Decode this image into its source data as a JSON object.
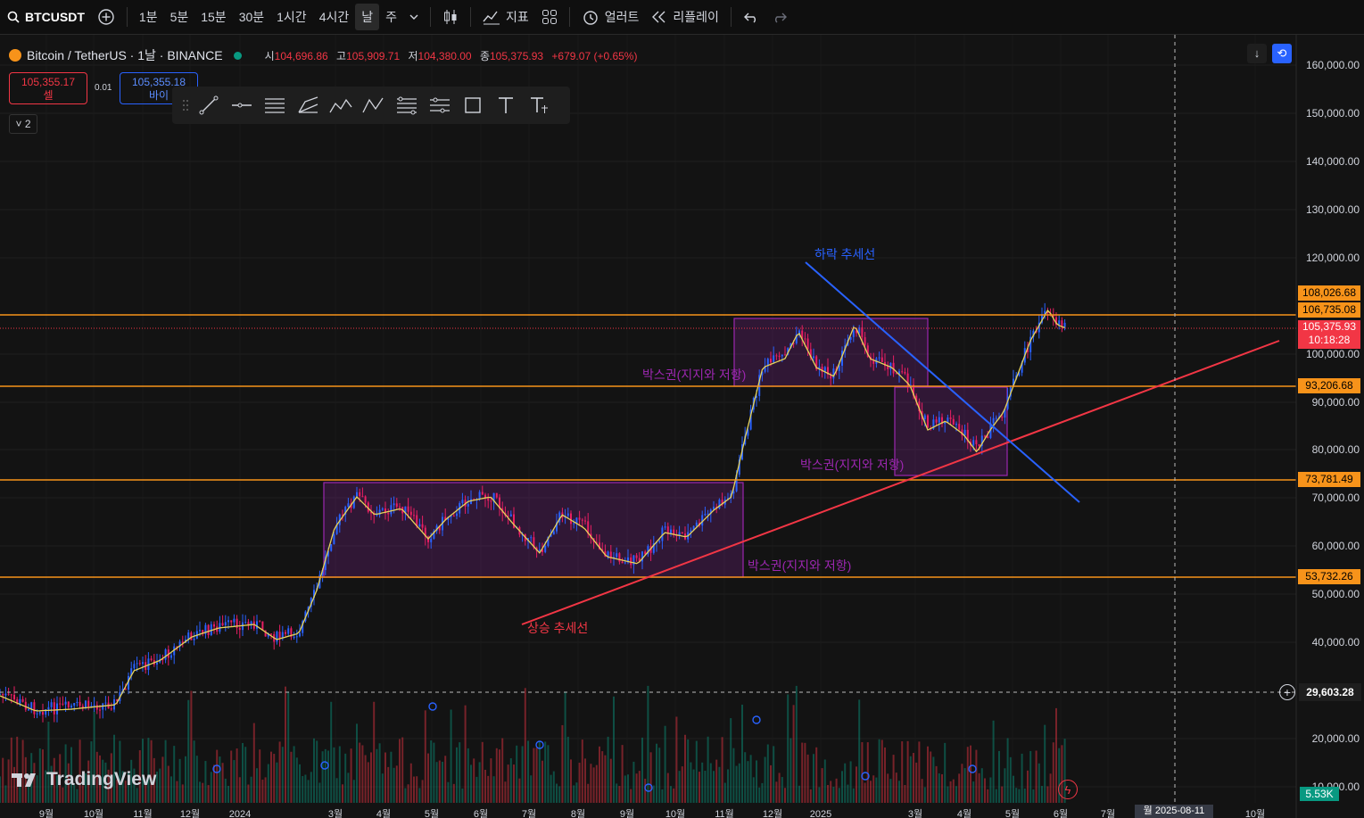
{
  "toolbar": {
    "symbol": "BTCUSDT",
    "intervals": [
      "1분",
      "5분",
      "15분",
      "30분",
      "1시간",
      "4시간",
      "날",
      "주"
    ],
    "active_interval": "날",
    "indicators_label": "지표",
    "alert_label": "얼러트",
    "replay_label": "리플레이"
  },
  "legend": {
    "title": "Bitcoin / TetherUS · 1날 · BINANCE",
    "open_label": "시",
    "open": "104,696.86",
    "high_label": "고",
    "high": "105,909.71",
    "low_label": "저",
    "low": "104,380.00",
    "close_label": "종",
    "close": "105,375.93",
    "change": "+679.07 (+0.65%)"
  },
  "trade": {
    "sell_price": "105,355.17",
    "sell_label": "셀",
    "spread": "0.01",
    "buy_price": "105,355.18",
    "buy_label": "바이"
  },
  "collapse_count": "2",
  "annotations": {
    "down_trend": "하락 추세선",
    "up_trend": "상승 추세선",
    "box_label": "박스권(지지와 저항)"
  },
  "price_axis": [
    "160,000.00",
    "150,000.00",
    "140,000.00",
    "130,000.00",
    "120,000.00",
    "100,000.00",
    "90,000.00",
    "80,000.00",
    "70,000.00",
    "60,000.00",
    "50,000.00",
    "40,000.00",
    "20,000.00",
    "10,000.00"
  ],
  "price_tags": {
    "level_108": "108,026.68",
    "level_106": "106,735.08",
    "current": "105,375.93",
    "countdown": "10:18:28",
    "level_93": "93,206.68",
    "level_73": "73,781.49",
    "level_53": "53,732.26",
    "crosshair": "29,603.28"
  },
  "volume_badge": "5.53K",
  "time_axis": [
    "9월",
    "10월",
    "11월",
    "12월",
    "2024",
    "3월",
    "4월",
    "5월",
    "6월",
    "7월",
    "8월",
    "9월",
    "10월",
    "11월",
    "12월",
    "2025",
    "3월",
    "4월",
    "5월",
    "6월",
    "7월",
    "10월"
  ],
  "crosshair_date": "월 2025-08-11",
  "logo_text": "TradingView",
  "colors": {
    "background": "#131313",
    "horizontal_level": "#f7931a",
    "up_trend": "#f23645",
    "down_trend": "#2962ff",
    "box": "#9c27b0",
    "ma_line": "#e6d35a",
    "up_candle": "#2962ff",
    "down_candle": "#e91e63"
  }
}
